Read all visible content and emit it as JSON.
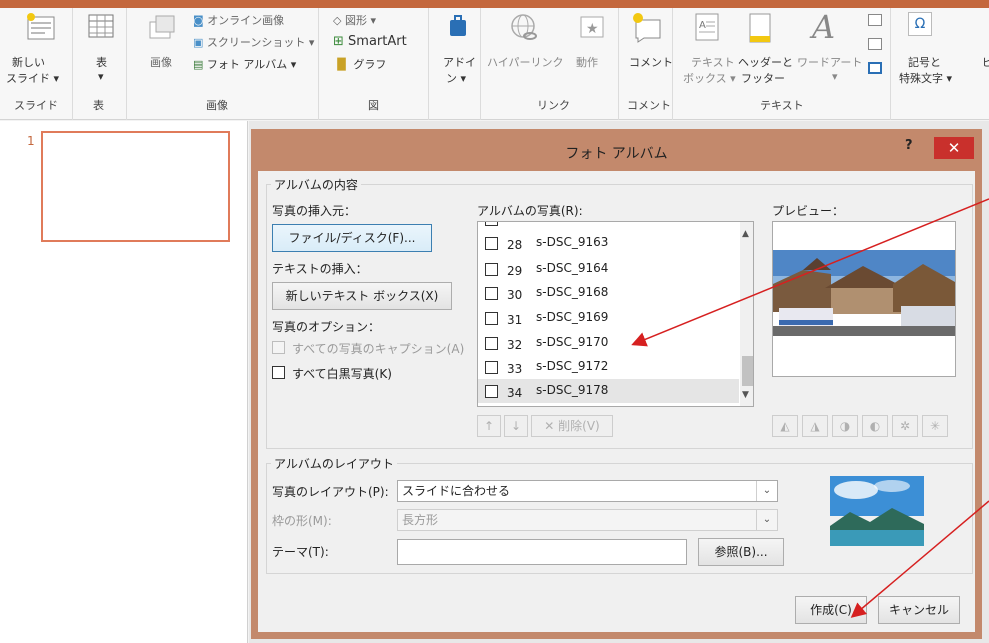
{
  "ribbon": {
    "new_slide": [
      "新しい",
      "スライド ▾"
    ],
    "table": [
      "表",
      "▾"
    ],
    "image": "画像",
    "online_image": "オンライン画像",
    "screenshot": "スクリーンショット ▾",
    "photo_album": "フォト アルバム ▾",
    "shapes": "図形 ▾",
    "smartart": "SmartArt",
    "graph": "グラフ",
    "addins": [
      "アドイ",
      "ン ▾"
    ],
    "hyperlink": "ハイパーリンク",
    "action": "動作",
    "comment": "コメント",
    "textbox": [
      "テキスト",
      "ボックス ▾"
    ],
    "header_footer": [
      "ヘッダーと",
      "フッター"
    ],
    "wordart": [
      "ワードアート",
      "▾"
    ],
    "symbols": [
      "記号と",
      "特殊文字 ▾"
    ],
    "cut_off": "ビ",
    "groups": {
      "slides": "スライド",
      "tables": "表",
      "images": "画像",
      "illustrations": "図",
      "links": "リンク",
      "comments": "コメント",
      "text": "テキスト"
    },
    "colors": {
      "accent": "#c4683e"
    }
  },
  "slide_panel": {
    "slide_number": "1"
  },
  "dialog": {
    "title": "フォト アルバム",
    "help": "?",
    "close": "✕",
    "content": {
      "legend": "アルバムの内容",
      "insert_from": "写真の挿入元：",
      "file_disk_button": "ファイル/ディスク(F)...",
      "insert_text": "テキストの挿入：",
      "new_textbox_button": "新しいテキスト ボックス(X)",
      "picture_options": "写真のオプション：",
      "captions_all": "すべての写真のキャプション(A)",
      "all_bw": "すべて白黒写真(K)",
      "pictures_in_album": "アルバムの写真(R):",
      "preview": "プレビュー：",
      "photos": [
        {
          "num": "28",
          "name": "s-DSC_9163"
        },
        {
          "num": "29",
          "name": "s-DSC_9164"
        },
        {
          "num": "30",
          "name": "s-DSC_9168"
        },
        {
          "num": "31",
          "name": "s-DSC_9169"
        },
        {
          "num": "32",
          "name": "s-DSC_9170"
        },
        {
          "num": "33",
          "name": "s-DSC_9172"
        },
        {
          "num": "34",
          "name": "s-DSC_9178"
        }
      ],
      "up": "↑",
      "down": "↓",
      "remove": "✕ 削除(V)"
    },
    "layout": {
      "legend": "アルバムのレイアウト",
      "picture_layout_label": "写真のレイアウト(P):",
      "picture_layout_value": "スライドに合わせる",
      "frame_shape_label": "枠の形(M):",
      "frame_shape_value": "長方形",
      "theme_label": "テーマ(T):",
      "theme_value": "",
      "browse_button": "参照(B)..."
    },
    "create_button": "作成(C)",
    "cancel_button": "キャンセル"
  },
  "colors": {
    "dialog_frame": "#c3896c",
    "close_button": "#c9302c",
    "annotation_arrow": "#d62020"
  }
}
